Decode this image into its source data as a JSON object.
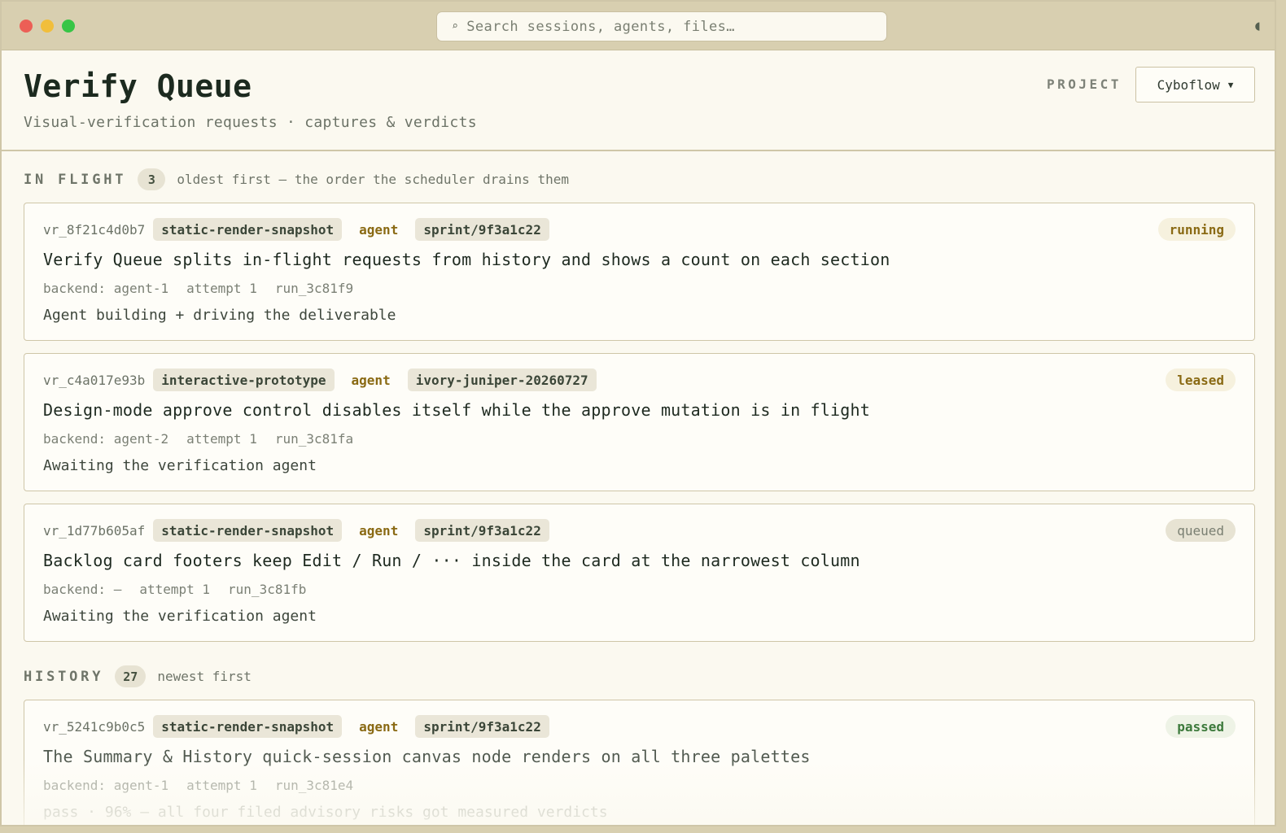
{
  "search": {
    "placeholder": "Search sessions, agents, files…"
  },
  "header": {
    "title": "Verify Queue",
    "subtitle": "Visual-verification requests · captures & verdicts",
    "project_label": "PROJECT",
    "project_value": "Cyboflow"
  },
  "in_flight": {
    "title": "IN FLIGHT",
    "count": "3",
    "note": "oldest first — the order the scheduler drains them",
    "cards": [
      {
        "id": "vr_8f21c4d0b7",
        "kind": "static-render-snapshot",
        "actor": "agent",
        "ref": "sprint/9f3a1c22",
        "status": "running",
        "title": "Verify Queue splits in-flight requests from history and shows a count on each section",
        "backend": "backend: agent-1",
        "attempt": "attempt 1",
        "run": "run_3c81f9",
        "desc": "Agent building + driving the deliverable"
      },
      {
        "id": "vr_c4a017e93b",
        "kind": "interactive-prototype",
        "actor": "agent",
        "ref": "ivory-juniper-20260727",
        "status": "leased",
        "title": "Design-mode approve control disables itself while the approve mutation is in flight",
        "backend": "backend: agent-2",
        "attempt": "attempt 1",
        "run": "run_3c81fa",
        "desc": "Awaiting the verification agent"
      },
      {
        "id": "vr_1d77b605af",
        "kind": "static-render-snapshot",
        "actor": "agent",
        "ref": "sprint/9f3a1c22",
        "status": "queued",
        "title": "Backlog card footers keep Edit / Run / ··· inside the card at the narrowest column",
        "backend": "backend: —",
        "attempt": "attempt 1",
        "run": "run_3c81fb",
        "desc": "Awaiting the verification agent"
      }
    ]
  },
  "history": {
    "title": "HISTORY",
    "count": "27",
    "note": "newest first",
    "cards": [
      {
        "id": "vr_5241c9b0c5",
        "kind": "static-render-snapshot",
        "actor": "agent",
        "ref": "sprint/9f3a1c22",
        "status": "passed",
        "title": "The Summary & History quick-session canvas node renders on all three palettes",
        "backend": "backend: agent-1",
        "attempt": "attempt 1",
        "run": "run_3c81e4",
        "desc": "pass · 96% — all four filed advisory risks got measured verdicts"
      }
    ]
  },
  "colors": {
    "titlebar": "#d8cfb0",
    "background": "#fbf9f0",
    "border": "#cfc6a8",
    "agent": "#8a6a14",
    "passed": "#3d7a3c",
    "close": "#ec5f56",
    "minimize": "#f1be3b",
    "zoom": "#37c546"
  }
}
